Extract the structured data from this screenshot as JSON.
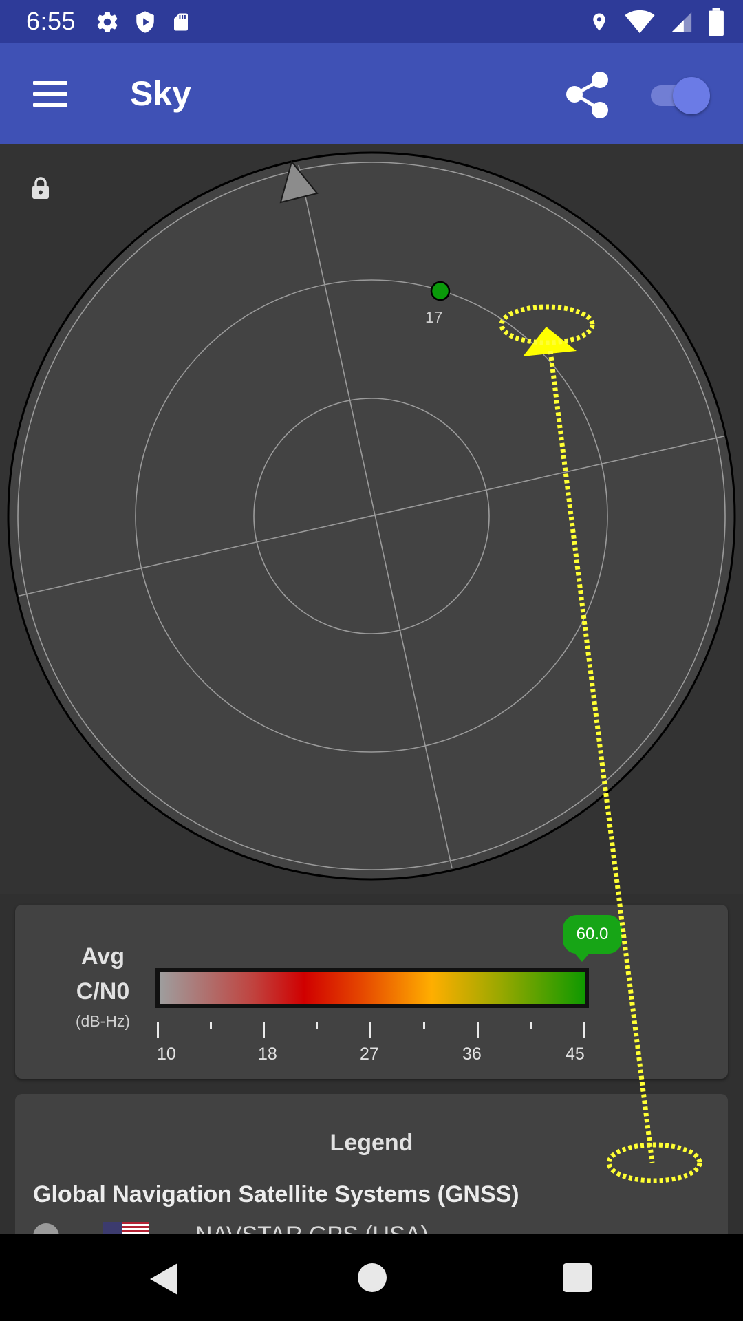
{
  "status_bar": {
    "time": "6:55",
    "left_icons": [
      "settings-icon",
      "shield-play-icon",
      "sd-card-icon"
    ],
    "right_icons": [
      "location-icon",
      "wifi-icon",
      "signal-icon",
      "battery-icon"
    ]
  },
  "app_bar": {
    "title": "Sky",
    "menu_icon": "hamburger-menu-icon",
    "share_icon": "share-icon",
    "toggle_on": true,
    "colors": {
      "status_bar": "#2E3B99",
      "app_bar": "#3F51B5"
    }
  },
  "sky": {
    "lock_icon": "lock-icon",
    "satellites": [
      {
        "id": "17",
        "color": "#0A9A0A",
        "shape": "circle"
      }
    ],
    "highlight_color": "#FFFF00"
  },
  "cn0": {
    "title_line1": "Avg",
    "title_line2": "C/N0",
    "unit": "(dB-Hz)",
    "value": "60.0",
    "ticks": [
      "10",
      "18",
      "27",
      "36",
      "45"
    ],
    "badge_color": "#17A516"
  },
  "legend": {
    "title": "Legend",
    "gnss_heading": "Global Navigation Satellite Systems (GNSS)",
    "rows": [
      {
        "label": "NAVSTAR GPS (USA)",
        "flag": "us-flag-icon"
      }
    ]
  },
  "nav_bar": {
    "buttons": [
      "back-button",
      "home-button",
      "recents-button"
    ]
  }
}
